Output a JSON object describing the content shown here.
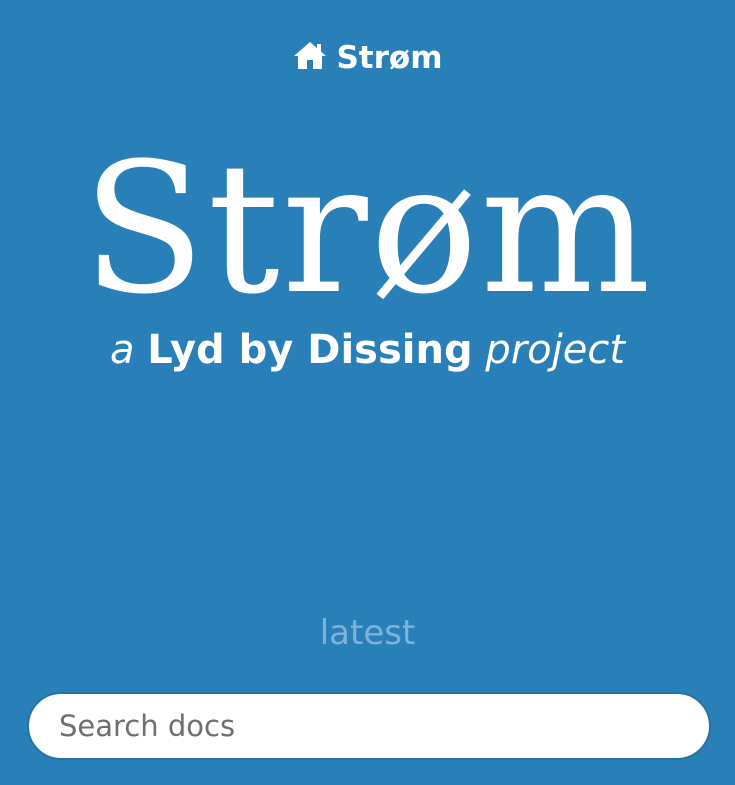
{
  "header": {
    "home_icon": "home-icon",
    "project_name": "Strøm"
  },
  "hero": {
    "title": "Strøm",
    "tagline": {
      "prefix": "a",
      "company": "Lyd by Dissing",
      "suffix": "project"
    }
  },
  "version": {
    "label": "latest"
  },
  "search": {
    "placeholder": "Search docs",
    "value": ""
  },
  "colors": {
    "background": "#2980b9",
    "text": "#ffffff",
    "version_text": "#7fb2d7"
  }
}
